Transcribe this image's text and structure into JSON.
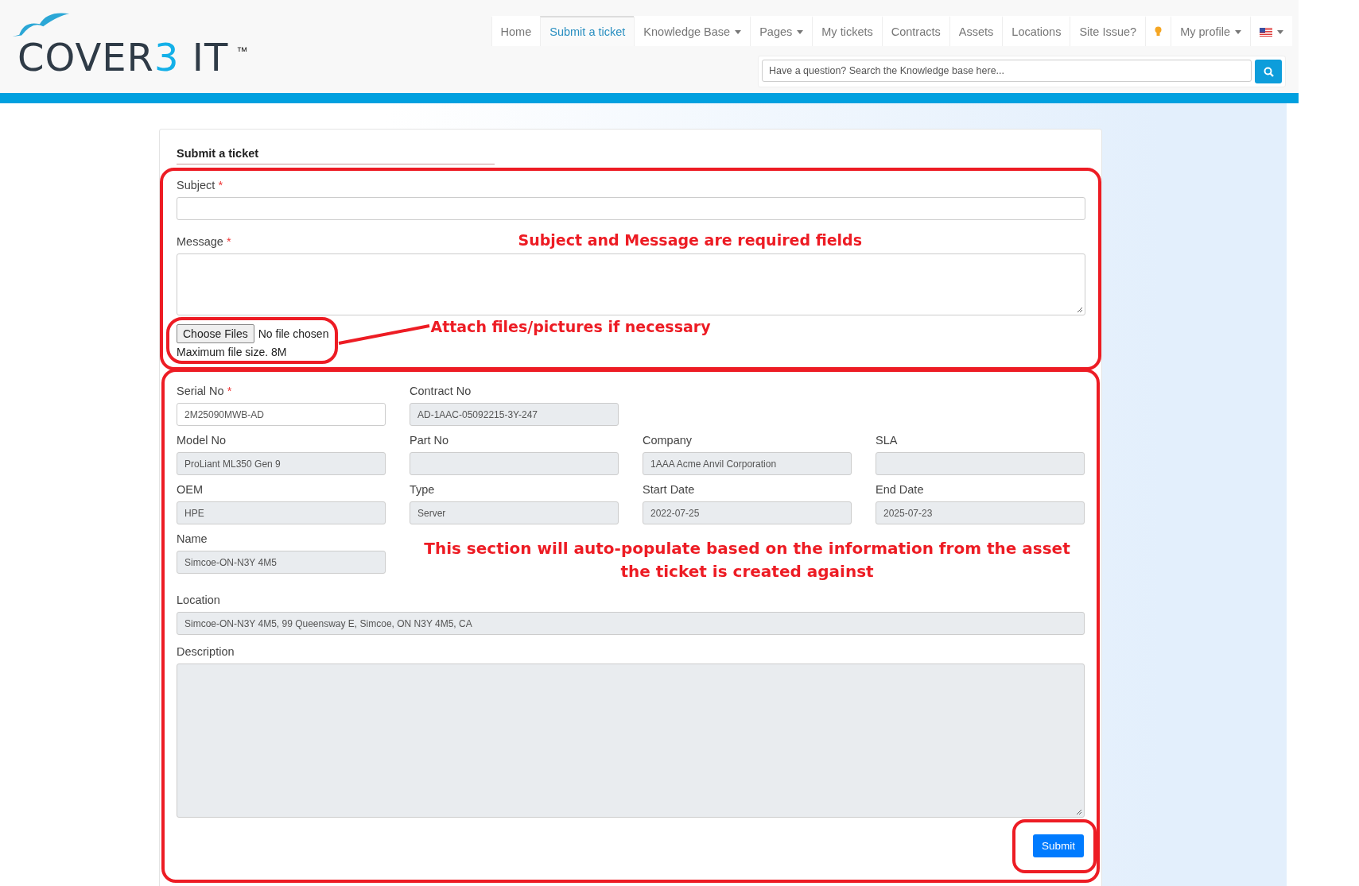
{
  "logo": {
    "text_1": "COVER",
    "highlight": "3",
    "text_2": "IT",
    "mark": "™"
  },
  "nav": [
    {
      "kind": "text",
      "label": "Home",
      "selected": false,
      "dropdown": false
    },
    {
      "kind": "text",
      "label": "Submit a ticket",
      "selected": true,
      "dropdown": false
    },
    {
      "kind": "text",
      "label": "Knowledge Base",
      "selected": false,
      "dropdown": true
    },
    {
      "kind": "text",
      "label": "Pages",
      "selected": false,
      "dropdown": true
    },
    {
      "kind": "text",
      "label": "My tickets",
      "selected": false,
      "dropdown": false
    },
    {
      "kind": "text",
      "label": "Contracts",
      "selected": false,
      "dropdown": false
    },
    {
      "kind": "text",
      "label": "Assets",
      "selected": false,
      "dropdown": false
    },
    {
      "kind": "text",
      "label": "Locations",
      "selected": false,
      "dropdown": false
    },
    {
      "kind": "text",
      "label": "Site Issue?",
      "selected": false,
      "dropdown": false
    },
    {
      "kind": "lightbulb",
      "selected": false,
      "dropdown": false
    },
    {
      "kind": "text",
      "label": "My profile",
      "selected": false,
      "dropdown": true
    },
    {
      "kind": "flag",
      "selected": false,
      "dropdown": true
    }
  ],
  "search": {
    "placeholder": "Have a question? Search the Knowledge base here..."
  },
  "form": {
    "title": "Submit a ticket",
    "subject": {
      "label": "Subject",
      "mark": "*"
    },
    "message": {
      "label": "Message",
      "mark": "*"
    },
    "required_note": "Subject and Message are required fields",
    "file": {
      "button": "Choose Files",
      "status": "No file chosen",
      "hint": "Maximum file size. 8M",
      "note": "Attach files/pictures if necessary"
    },
    "asset_rows": [
      [
        {
          "label": "Serial No",
          "mark": "*",
          "value": "2M25090MWB-AD",
          "readonly": false
        },
        {
          "label": "Contract No",
          "value": "AD-1AAC-05092215-3Y-247",
          "readonly": true
        }
      ],
      [
        {
          "label": "Model No",
          "value": "ProLiant ML350 Gen 9",
          "readonly": true
        },
        {
          "label": "Part No",
          "readonly": true
        },
        {
          "label": "Company",
          "value": "1AAA Acme Anvil Corporation",
          "readonly": true
        },
        {
          "label": "SLA",
          "readonly": true
        }
      ],
      [
        {
          "label": "OEM",
          "value": "HPE",
          "readonly": true
        },
        {
          "label": "Type",
          "value": "Server",
          "readonly": true
        },
        {
          "label": "Start Date",
          "value": "2022-07-25",
          "readonly": true
        },
        {
          "label": "End Date",
          "value": "2025-07-23",
          "readonly": true
        }
      ],
      [
        {
          "label": "Name",
          "value": "Simcoe-ON-N3Y 4M5",
          "readonly": true
        }
      ]
    ],
    "auto_note": "This section will auto-populate based on the information from the asset the ticket is created against",
    "location": {
      "label": "Location",
      "value": "Simcoe-ON-N3Y 4M5, 99 Queensway E, Simcoe, ON N3Y 4M5, CA",
      "readonly": true
    },
    "description": {
      "label": "Description",
      "readonly": true
    },
    "submit": "Submit"
  }
}
